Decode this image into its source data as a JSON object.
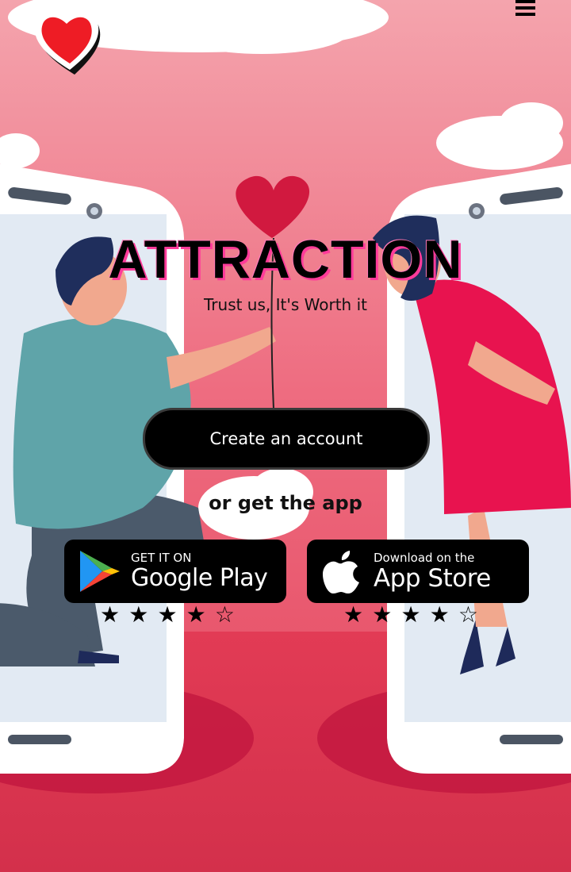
{
  "header": {
    "logo_icon": "heart-logo-icon",
    "menu_icon": "hamburger-menu-icon"
  },
  "hero": {
    "title": "ATTRACTION",
    "tagline": "Trust us, It's Worth it",
    "cta_label": "Create an account",
    "or_text": "or get the app"
  },
  "stores": {
    "google": {
      "icon": "google-play-icon",
      "small_label": "GET IT ON",
      "big_label": "Google Play",
      "rating": 4,
      "rating_max": 5
    },
    "apple": {
      "icon": "apple-icon",
      "small_label": "Download on the",
      "big_label": "App Store",
      "rating": 4,
      "rating_max": 5
    }
  },
  "colors": {
    "primary": "#e9205e",
    "accent": "#ff3b9a",
    "dark": "#000000"
  }
}
